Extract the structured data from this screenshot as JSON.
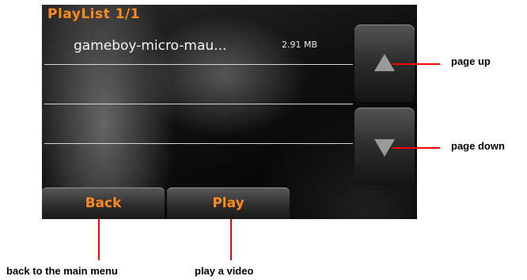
{
  "playlist": {
    "title": "PlayList  1/1",
    "items": [
      {
        "name": "gameboy-micro-mau...",
        "size": "2.91 MB"
      }
    ]
  },
  "buttons": {
    "back": "Back",
    "play": "Play",
    "page_up_icon": "triangle-up-icon",
    "page_down_icon": "triangle-down-icon"
  },
  "annotations": {
    "page_up": "page up",
    "page_down": "page down",
    "back": "back to the main menu",
    "play": "play a video"
  },
  "colors": {
    "accent": "#ff8a1c",
    "callout": "#ff0000"
  }
}
